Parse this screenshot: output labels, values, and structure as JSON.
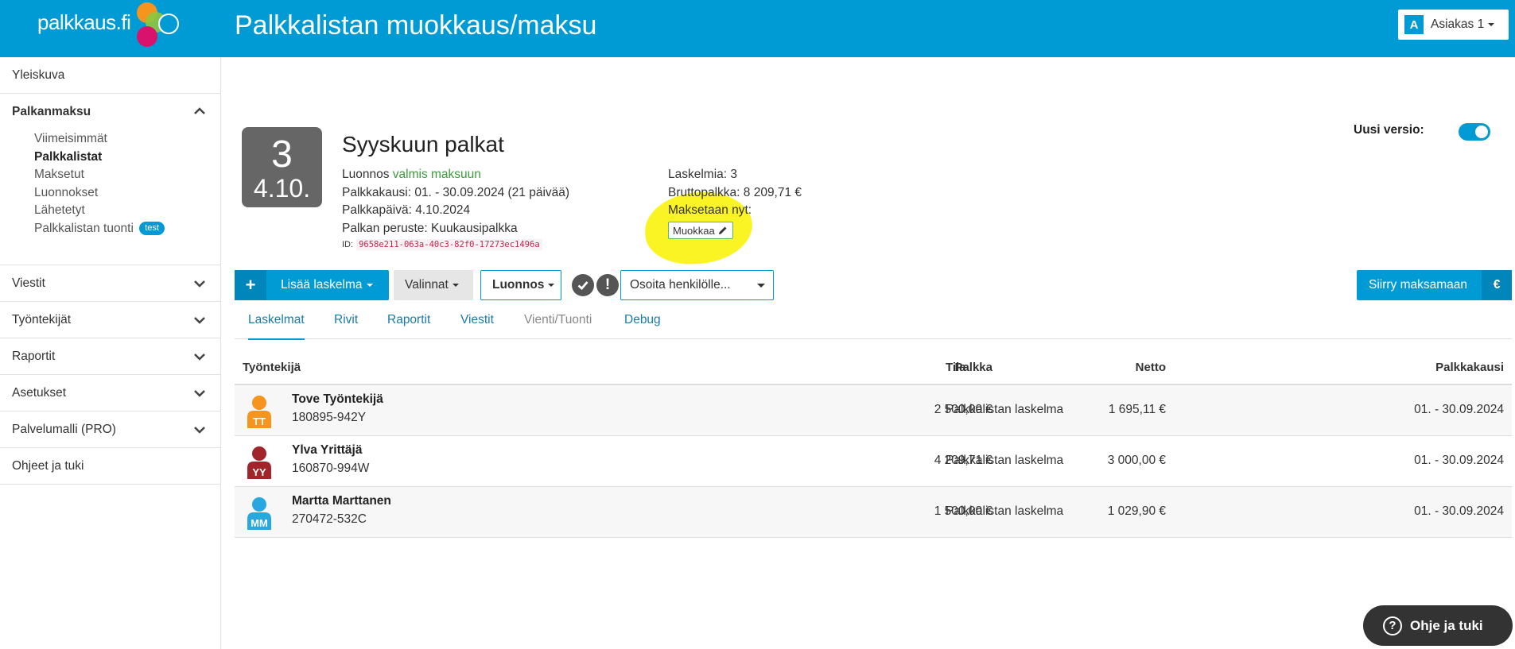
{
  "logo": {
    "text": "palkkaus.fi"
  },
  "header": {
    "title": "Palkkalistan muokkaus/maksu",
    "user_initial": "A",
    "user_name": "Asiakas 1"
  },
  "sidebar": {
    "overview": "Yleiskuva",
    "payroll": {
      "label": "Palkanmaksu",
      "items": [
        "Viimeisimmät",
        "Palkkalistat",
        "Maksetut",
        "Luonnokset",
        "Lähetetyt",
        "Palkkalistan tuonti"
      ],
      "active_index": 1,
      "import_badge": "test"
    },
    "messages": "Viestit",
    "employees": "Työntekijät",
    "reports": "Raportit",
    "settings": "Asetukset",
    "service_model": "Palvelumalli (PRO)",
    "help": "Ohjeet ja tuki"
  },
  "run": {
    "count": "3",
    "pay_date_short": "4.10.",
    "title": "Syyskuun palkat",
    "status_label": "Luonnos",
    "status_value": "valmis maksuun",
    "period": "Palkkakausi: 01. - 30.09.2024 (21 päivää)",
    "pay_date": "Palkkapäivä: 4.10.2024",
    "basis": "Palkan peruste: Kuukausipalkka",
    "id_label": "ID:",
    "id_value": "9658e211-063a-40c3-82f0-17273ec1496a",
    "calc_count": "Laskelmia: 3",
    "gross": "Bruttopalkka: 8 209,71 €",
    "pay_now": "Maksetaan nyt:",
    "edit_label": "Muokkaa"
  },
  "new_version": {
    "label": "Uusi versio:",
    "enabled": true
  },
  "toolbar": {
    "add_label": "Lisää laskelma",
    "choices_label": "Valinnat",
    "status_label": "Luonnos",
    "assign_placeholder": "Osoita henkilölle...",
    "pay_label": "Siirry maksamaan",
    "pay_currency": "€"
  },
  "tabs": [
    {
      "label": "Laskelmat",
      "active": true
    },
    {
      "label": "Rivit"
    },
    {
      "label": "Raportit"
    },
    {
      "label": "Viestit"
    },
    {
      "label": "Vienti/Tuonti",
      "muted": true
    },
    {
      "label": "Debug"
    }
  ],
  "table": {
    "headers": {
      "employee": "Työntekijä",
      "salary": "Palkka",
      "net": "Netto",
      "state": "Tila",
      "period": "Palkkakausi"
    },
    "rows": [
      {
        "initials": "TT",
        "color": "#f7941d",
        "name": "Tove Työntekijä",
        "ssn": "180895-942Y",
        "salary": "2 500,00 €",
        "net": "1 695,11 €",
        "state": "Palkkalistan laskelma",
        "period": "01. - 30.09.2024"
      },
      {
        "initials": "YY",
        "color": "#a0242a",
        "name": "Ylva Yrittäjä",
        "ssn": "160870-994W",
        "salary": "4 209,71 €",
        "net": "3 000,00 €",
        "state": "Palkkalistan laskelma",
        "period": "01. - 30.09.2024"
      },
      {
        "initials": "MM",
        "color": "#29a8e0",
        "name": "Martta Marttanen",
        "ssn": "270472-532C",
        "salary": "1 500,00 €",
        "net": "1 029,90 €",
        "state": "Palkkalistan laskelma",
        "period": "01. - 30.09.2024"
      }
    ]
  },
  "help_button": "Ohje ja tuki",
  "colors": {
    "brand": "#009ad4",
    "success": "#3c9a3c",
    "highlight": "#fbf424"
  }
}
